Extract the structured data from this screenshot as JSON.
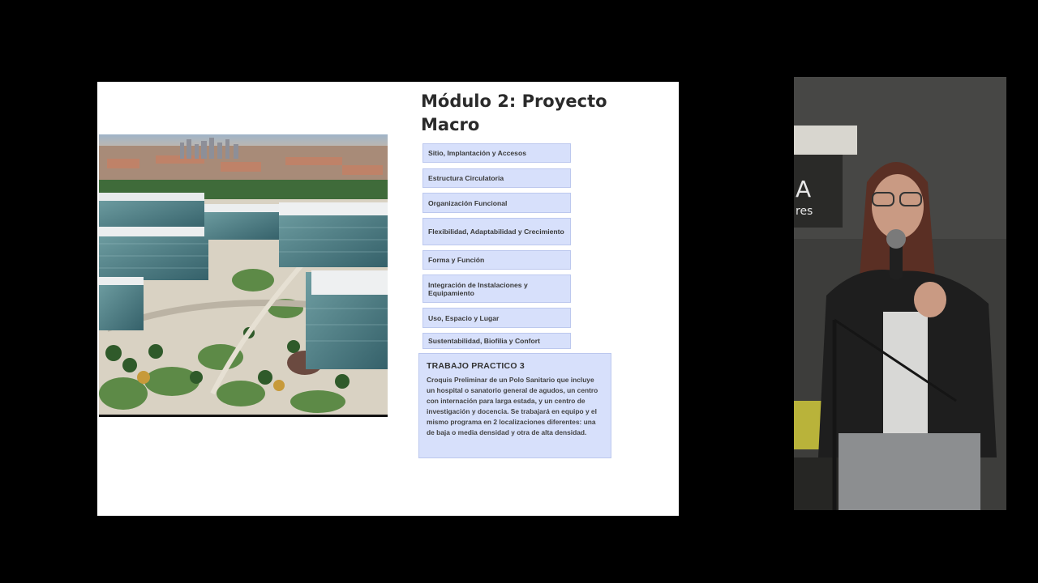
{
  "slide": {
    "title": "Módulo 2: Proyecto Macro",
    "topics": [
      "Sitio, Implantación y Accesos",
      "Estructura Circulatoria",
      "Organización Funcional",
      "Flexibilidad, Adaptabilidad y Crecimiento",
      "Forma y Función",
      "Integración de Instalaciones y Equipamiento",
      "Uso, Espacio y Lugar",
      "Sustentabilidad, Biofilia y Confort"
    ],
    "assignment": {
      "title": "TRABAJO PRACTICO 3",
      "body": "Croquis Preliminar de un Polo Sanitario que incluye un hospital o sanatorio general de agudos, un centro con internación para larga estada, y un centro de investigación y docencia. Se trabajará en equipo y el mismo programa en 2 localizaciones diferentes: una de baja o media densidad y otra de alta densidad."
    },
    "image": "aerial-hospital-campus-illustration"
  },
  "speaker_video": {
    "subject": "speaker-with-microphone",
    "wall_sign_text": "A\nres"
  },
  "colors": {
    "background": "#000000",
    "slide_bg": "#ffffff",
    "card_bg": "#d7e0fb",
    "card_border": "#bcc8ee",
    "title_color": "#2a2a2a"
  }
}
